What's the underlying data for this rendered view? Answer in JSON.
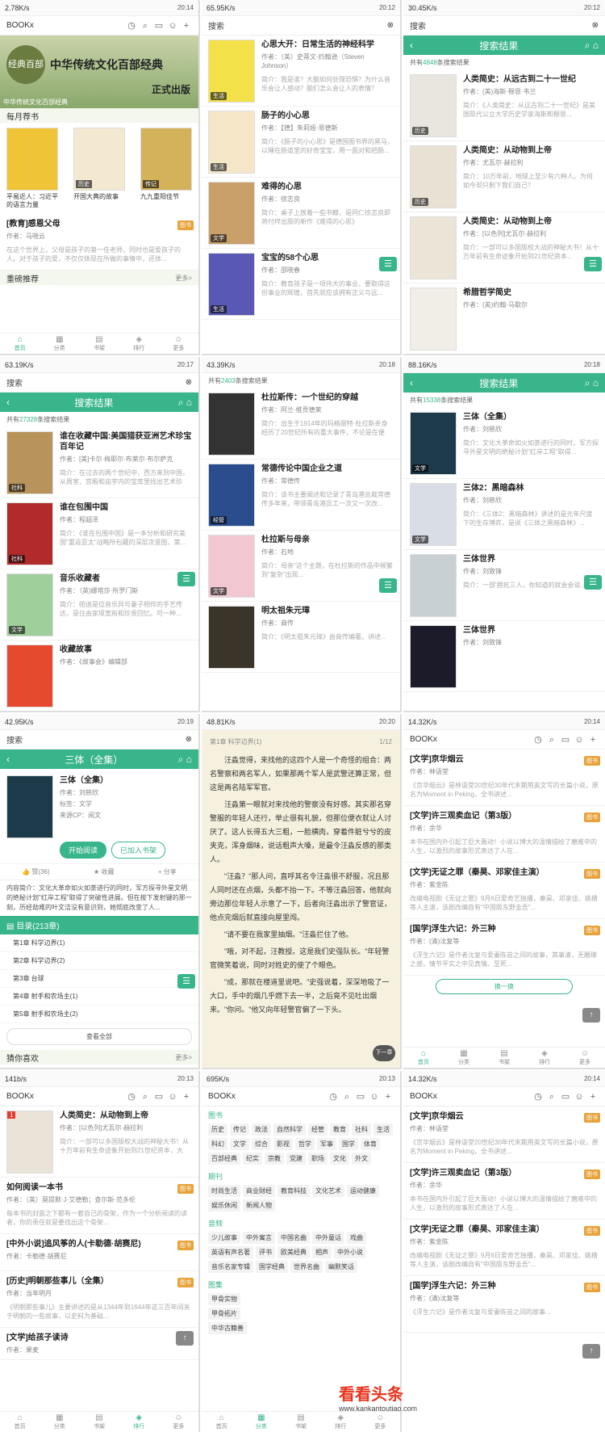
{
  "status_times": [
    "20:14",
    "20:12",
    "20:12",
    "20:17",
    "20:18",
    "20:18",
    "20:19",
    "20:20",
    "20:14",
    "20:13",
    "20:13",
    "20:14"
  ],
  "status_speeds": [
    "2.78K/s",
    "65.95K/s",
    "30.45K/s",
    "63.19K/s",
    "43.39K/s",
    "88.16K/s",
    "42.95K/s",
    "48.81K/s",
    "14.32K/s",
    "141b/s",
    "695K/s",
    "14.32K/s"
  ],
  "app_title": "BOOKx",
  "search_label": "搜索",
  "results_title": "搜索结果",
  "nav": [
    "首页",
    "分类",
    "书架",
    "排行",
    "更多"
  ],
  "p1": {
    "banner_seal": "经典百部",
    "banner_title": "中华传统文化百部经典",
    "banner_sub": "正式出版",
    "banner_caption": "中华传统文化百部经典",
    "section": "每月荐书",
    "more": "更多>",
    "recs": [
      {
        "title": "平易近人：习近平的语言力量",
        "author": "",
        "tag": ""
      },
      {
        "title": "开国大典的故事",
        "author": "",
        "tag": "历史"
      },
      {
        "title": "九九重阳佳节",
        "author": "",
        "tag": "传记"
      }
    ],
    "article": {
      "title": "[教育]感恩父母",
      "author": "作者：马晓云",
      "desc": "在这个世界上，父母是孩子的第一任老师，同时也是爱孩子的人。对于孩子的爱，不仅仅体现在所做的事情中，还体...",
      "badge": "图书"
    },
    "section2": "重磅推荐"
  },
  "p2": {
    "items": [
      {
        "title": "心思大开：日常生活的神经科学",
        "author": "作者：（美）史蒂文·约翰逊（Steven Johnson）",
        "desc": "简介：我是谁？大脑如何处理恐惧？为什么音乐会让人感动？脑们怎么会让人的表情？",
        "tag": "生活"
      },
      {
        "title": "肠子的小心思",
        "author": "作者：【德】朱莉娅·恩德斯",
        "desc": "简介：《肠子的小心思》是德国图书界的黑马，以睡在肠道里的好奇宝宝，用一面对和把肠...",
        "tag": "生活"
      },
      {
        "title": "难得的心思",
        "author": "作者：徐志良",
        "desc": "简介：桌子上放着一些书籍，是同仁徐志良即将付梓出版的新作《难得的心思》",
        "tag": "文学"
      },
      {
        "title": "宝宝的58个心思",
        "author": "作者：邵晓春",
        "desc": "简介：教育孩子是一项伟大的事业，要取得这份事业的辉煌，首先就应该拥有正义与远...",
        "tag": "生活"
      }
    ]
  },
  "p3": {
    "count_pre": "共有",
    "count": "4848",
    "count_post": "条搜索结果",
    "items": [
      {
        "title": "人类简史：从远古到二十一世纪",
        "author": "作者：(美)海斯·穆恩·韦兰",
        "desc": "简介：《人类简史：从远古到二十一世纪》是美国现代公立大学历史学家海斯和穆恩...",
        "tag": "历史"
      },
      {
        "title": "人类简史：从动物到上帝",
        "author": "作者：尤瓦尔·赫拉利",
        "desc": "简介：10万年前，地球上至少有六种人。为何如今却只剩下我们自己？",
        "tag": "历史"
      },
      {
        "title": "人类简史：从动物到上帝",
        "author": "作者：[以色列]尤瓦尔·赫拉利",
        "desc": "简介：一部可以多国版权大战的神秘大书！从十万年前有生命迹象开始到21世纪资本...",
        "tag": ""
      },
      {
        "title": "希腊哲学简史",
        "author": "作者：(英)约翰·马歇尔",
        "desc": "",
        "tag": ""
      }
    ]
  },
  "p4": {
    "count_pre": "共有",
    "count": "27328",
    "count_post": "条搜索结果",
    "items": [
      {
        "title": "谁在收藏中国:美国猎获亚洲艺术珍宝百年记",
        "author": "作者：[美]卡尔·梅耶尔·布莱尔·布尔萨克",
        "desc": "简介：在过去的两个世纪中，西方来到中国，从周室、宫殿和庙宇内的宝库里找出艺术珍品...",
        "tag": "社科"
      },
      {
        "title": "谁在包围中国",
        "author": "作者：程超泽",
        "desc": "简介：《谁在包围中国》是一本分析和研究美国\"重返亚太\"战略所包藏的深层次意图、策...",
        "tag": "社科"
      },
      {
        "title": "音乐收藏者",
        "author": "作者：（英)娜塔莎·所罗门斯",
        "desc": "简介：帕迪是位音乐异与妻子相伴的手艺传达，是住由家境宽裕和珍贵回忆。可一种...",
        "tag": "文学"
      },
      {
        "title": "收藏故事",
        "author": "作者：《故事会》编辑部",
        "desc": "",
        "tag": ""
      }
    ]
  },
  "p5": {
    "count_pre": "共有",
    "count": "2403",
    "count_post": "条搜索结果",
    "items": [
      {
        "title": "杜拉斯传：一个世纪的穿越",
        "author": "作者：阿兰·维贡德莱",
        "desc": "简介：出生于1914年的玛格丽特·杜拉斯亲身经历了20世纪所有的重大事件，不论是在便国...",
        "tag": ""
      },
      {
        "title": "常德传论中国企业之道",
        "author": "作者：常德传",
        "desc": "简介：该书主要阐述和记录了青岛港总裁常德传多年来，带领青岛港员工一次又一次改...",
        "tag": "经管"
      },
      {
        "title": "杜拉斯与母亲",
        "author": "作者：石地",
        "desc": "简介：母亲\"这个主题，在杜拉斯的作品中频繁到\"复杂\"出现...",
        "tag": "文学"
      },
      {
        "title": "明太祖朱元璋",
        "author": "作者：商传",
        "desc": "简介：《明太祖朱元璋》由商传编著。讲述...",
        "tag": ""
      }
    ]
  },
  "p6": {
    "count_pre": "共有",
    "count": "15338",
    "count_post": "条搜索结果",
    "items": [
      {
        "title": "三体（全集）",
        "author": "作者：刘慈欣",
        "desc": "简介：文化大革命如火如荼进行的同时，军方探寻外星文明的绝秘计划\"红岸工程\"取得...",
        "tag": "文学"
      },
      {
        "title": "三体2：黑暗森林",
        "author": "作者：刘慈欣",
        "desc": "简介：《三体2：黑暗森林》讲述的是光年尺度下的生存博弈，是说《三体之黑暗森林》...",
        "tag": "文学"
      },
      {
        "title": "三体世界",
        "author": "作者：刘致锋",
        "desc": "简介：一部'拥抗三人，你知道的就会会说...",
        "tag": ""
      },
      {
        "title": "三体世界",
        "author": "作者：刘致锋",
        "desc": "",
        "tag": ""
      }
    ]
  },
  "p7": {
    "title": "三体（全集）",
    "author": "作者：刘慈欣",
    "category": "标签：文学",
    "cp": "来源CP：阅文",
    "read_btn": "开始阅读",
    "shelf_btn": "已加入书架",
    "like": "赞(36)",
    "collect": "收藏",
    "share": "分享",
    "intro": "内容简介：文化大革命如火如荼进行的同时，军方探寻外星文明的绝秘计划\"红岸工程\"取得了突破性进展。但在按下发射键的那一刻，历经劫难的叶文洁没有意识到，她彻底改变了人...",
    "toc_head": "目录(213章)",
    "toc": [
      "第1章 科学边界(1)",
      "第2章 科学边界(2)",
      "第3章 台球",
      "第4章 射手和农场主(1)",
      "第5章 射手和农场主(2)"
    ],
    "view_all": "查看全部",
    "guess": "猜你喜欢",
    "more": "更多>"
  },
  "p8": {
    "chapter": "第1章 科学边界(1)",
    "page": "1/12",
    "paras": [
      "汪淼觉得，来找他的这四个人是一个奇怪的组合：两名警察和两名军人，如果那两个军人是武警还算正常，但这是两名陆军军官。",
      "汪淼第一眼就对来找他的警察没有好感。其实那名穿警服的年轻人还行，举止很有礼貌，但那位便衣就让人讨厌了。这人长得五大三粗，一脸横肉，穿着件脏兮兮的皮夹克，浑身烟味，说话粗声大嗓，是最令汪淼反感的那类人。",
      "\"汪淼？\"那人问，直呼其名令汪淼很不舒服，况且那人同时还在点烟，头都不抬一下。不等汪淼回答，他就向旁边那位年轻人示意了一下，后者向汪淼出示了警官证，他点完烟后就直接向屋里闯。",
      "\"请不要在我家里抽烟。\"汪淼拦住了他。",
      "\"哦，对不起，汪教授。这是我们史强队长。\"年轻警官微笑着说，同时对姓史的使了个眼色。",
      "\"成，那就在楼道里说吧。\"史强说着，深深地吸了一大口，手中的烟几乎燃下去一半，之后竟不见吐出烟来。\"你问。\"他又向年轻警官偏了一下头。"
    ],
    "next": "下一章"
  },
  "p9": {
    "items": [
      {
        "title": "[文学]京华烟云",
        "author": "作者：林语堂",
        "desc": "《京华烟云》是林语堂20世纪30年代末期用英文写的长篇小说，原名为Moment in Peking，全书讲述...",
        "badge": "图书"
      },
      {
        "title": "[文学]许三观卖血记（第3版）",
        "author": "作者：余华",
        "desc": "本书在国内外引起了巨大轰动！小说以博大的温情描绘了磨难中的人生，以激烈的故事形式表达了人在...",
        "badge": "图书"
      },
      {
        "title": "[文学]无证之罪（秦昊、邓家佳主演）",
        "author": "作者：紫金陈",
        "desc": "改编电视剧《无证之罪》9月6日爱奇艺独播，秦昊、邓家佳、姚橹等人主演，该剧改编自有\"中国版东野圭吾\"...",
        "badge": "图书"
      },
      {
        "title": "[国学]浮生六记：外三种",
        "author": "作者：(清)沈复等",
        "desc": "《浮生六记》是作者沈复与爱妻陈芸之间的故事，其事清，无雕琢之感，情节平实之中见真情。至死...",
        "badge": "图书"
      }
    ],
    "huan": "换一换"
  },
  "p10": {
    "items": [
      {
        "title": "人类简史：从动物到上帝",
        "author": "作者：[以色列]尤瓦尔·赫拉利",
        "desc": "简介：一部可以多国版权大战的神秘大书！从十万年前有生命迹象开始到21世纪资本，大家...",
        "badge": ""
      },
      {
        "title": "如何阅读一本书",
        "author": "作者：（美）莫提默·J·艾德勒；查尔斯·范多伦",
        "desc": "每本书的封面之下都有一套自己的骨架，作为一个分析阅读的读者，你的责任就是要找出这个骨架...",
        "badge": "图书"
      },
      {
        "title": "[中外小说]追风筝的人(卡勒德·胡赛尼)",
        "author": "作者：卡勒德·胡赛尼",
        "desc": "",
        "badge": "图书"
      },
      {
        "title": "[历史]明朝那些事儿（全集）",
        "author": "作者：当年明月",
        "desc": "《明朝那些事儿》主要讲述的是从1344年到1644年这三百年间关于明朝的一些故事，以史料为基础...",
        "badge": "图书"
      },
      {
        "title": "[文学]给孩子读诗",
        "author": "作者：果麦",
        "desc": "",
        "badge": "图书"
      }
    ]
  },
  "p11": {
    "sections": [
      {
        "head": "图书",
        "tags": [
          "历史",
          "传记",
          "政法",
          "自然科学",
          "经管",
          "教育",
          "社科",
          "生活",
          "科幻",
          "文学",
          "综合",
          "影视",
          "哲学",
          "军事",
          "国学",
          "体育",
          "百部经典",
          "纪实",
          "宗教",
          "党建",
          "职场",
          "文化",
          "外文"
        ]
      },
      {
        "head": "期刊",
        "tags": [
          "时尚生活",
          "商业财经",
          "教育科技",
          "文化艺术",
          "运动健康",
          "娱乐休闲",
          "新闻人物"
        ]
      },
      {
        "head": "音频",
        "tags": [
          "少儿故事",
          "中外寓言",
          "中国名曲",
          "中外童话",
          "戏曲",
          "英语有声名著",
          "评书",
          "欧美经典",
          "相声",
          "中外小说",
          "音乐名家专辑",
          "国学经典",
          "世界名曲",
          "幽默笑话"
        ]
      },
      {
        "head": "图集",
        "tags": [
          "甲骨实物",
          "甲骨拓片",
          "中华古籍善"
        ]
      }
    ]
  },
  "p12": {
    "items": [
      {
        "title": "[文学]京华烟云",
        "author": "作者：林语堂",
        "desc": "《京华烟云》是林语堂20世纪30年代末期用英文写的长篇小说，原名为Moment in Peking，全书讲述...",
        "badge": "图书"
      },
      {
        "title": "[文学]许三观卖血记（第3版）",
        "author": "作者：余华",
        "desc": "本书在国内外引起了巨大轰动！小说以博大的温情描绘了磨难中的人生，以激烈的故事形式表达了人在...",
        "badge": "图书"
      },
      {
        "title": "[文学]无证之罪（秦昊、邓家佳主演）",
        "author": "作者：紫金陈",
        "desc": "改编电视剧《无证之罪》9月6日爱奇艺独播，秦昊、邓家佳、姚橹等人主演，该剧改编自有\"中国版东野圭吾\"...",
        "badge": "图书"
      },
      {
        "title": "[国学]浮生六记：外三种",
        "author": "作者：(清)沈复等",
        "desc": "《浮生六记》是作者沈复与爱妻陈芸之间的故事...",
        "badge": "图书"
      }
    ]
  },
  "watermark": "看看头条",
  "watermark_url": "www.kankantoutiao.com",
  "colors": {
    "accent": "#39b58c",
    "badge": "#e8a23a"
  }
}
